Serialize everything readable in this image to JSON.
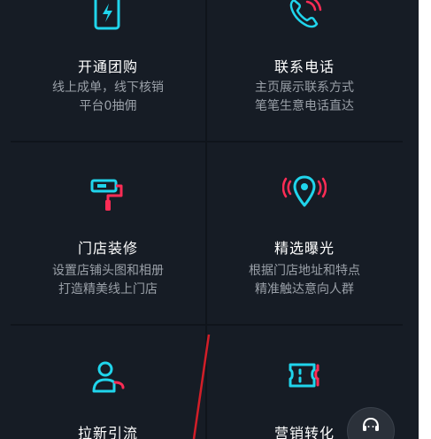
{
  "features": [
    {
      "title": "开通团购",
      "desc1": "线上成单，线下核销",
      "desc2": "平台0抽佣",
      "icon": "lightning-card-icon"
    },
    {
      "title": "联系电话",
      "desc1": "主页展示联系方式",
      "desc2": "笔笔生意电话直达",
      "icon": "phone-icon"
    },
    {
      "title": "门店装修",
      "desc1": "设置店铺头图和相册",
      "desc2": "打造精美线上门店",
      "icon": "paint-roller-icon"
    },
    {
      "title": "精选曝光",
      "desc1": "根据门店地址和特点",
      "desc2": "精准触达意向人群",
      "icon": "location-broadcast-icon"
    },
    {
      "title": "拉新引流",
      "desc1": "",
      "desc2": "",
      "icon": "user-icon"
    },
    {
      "title": "营销转化",
      "desc1": "",
      "desc2": "",
      "icon": "ticket-icon"
    }
  ],
  "service": {
    "label": "客服",
    "icon": "headset-icon"
  },
  "colors": {
    "cyan": "#20d5ec",
    "pink": "#fe2c55",
    "background": "#161c25"
  }
}
